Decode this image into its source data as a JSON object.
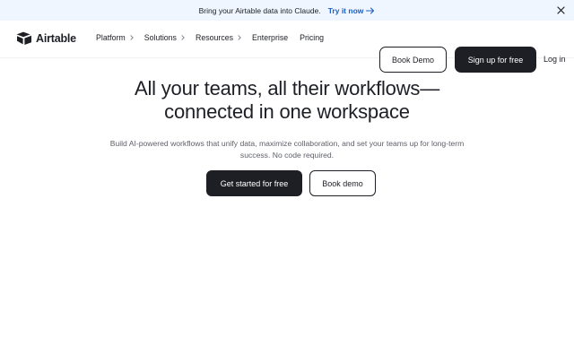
{
  "banner": {
    "message": "Bring your Airtable data into Claude.",
    "cta_label": "Try it now",
    "cta_icon": "arrow-right-icon",
    "close_icon": "close-icon"
  },
  "nav": {
    "logo_icon": "airtable-logo-icon",
    "logo_text": "Airtable",
    "items": [
      {
        "label": "Platform",
        "has_chevron": true
      },
      {
        "label": "Solutions",
        "has_chevron": true
      },
      {
        "label": "Resources",
        "has_chevron": true
      },
      {
        "label": "Enterprise",
        "has_chevron": false
      },
      {
        "label": "Pricing",
        "has_chevron": false
      }
    ],
    "book_demo_label": "Book Demo",
    "signup_label": "Sign up for free",
    "login_label": "Log in"
  },
  "hero": {
    "title_line1": "All your teams, all their workflows—",
    "title_line2": "connected in one workspace",
    "subtitle": "Build AI-powered workflows that unify data, maximize collaboration, and set your teams up for long-term success. No code required.",
    "primary_cta": "Get started for free",
    "secondary_cta": "Book demo"
  },
  "colors": {
    "banner_bg": "#f0f6ff",
    "link_blue": "#1a5ec7",
    "dark": "#1d1f25",
    "muted": "#5e6169"
  }
}
